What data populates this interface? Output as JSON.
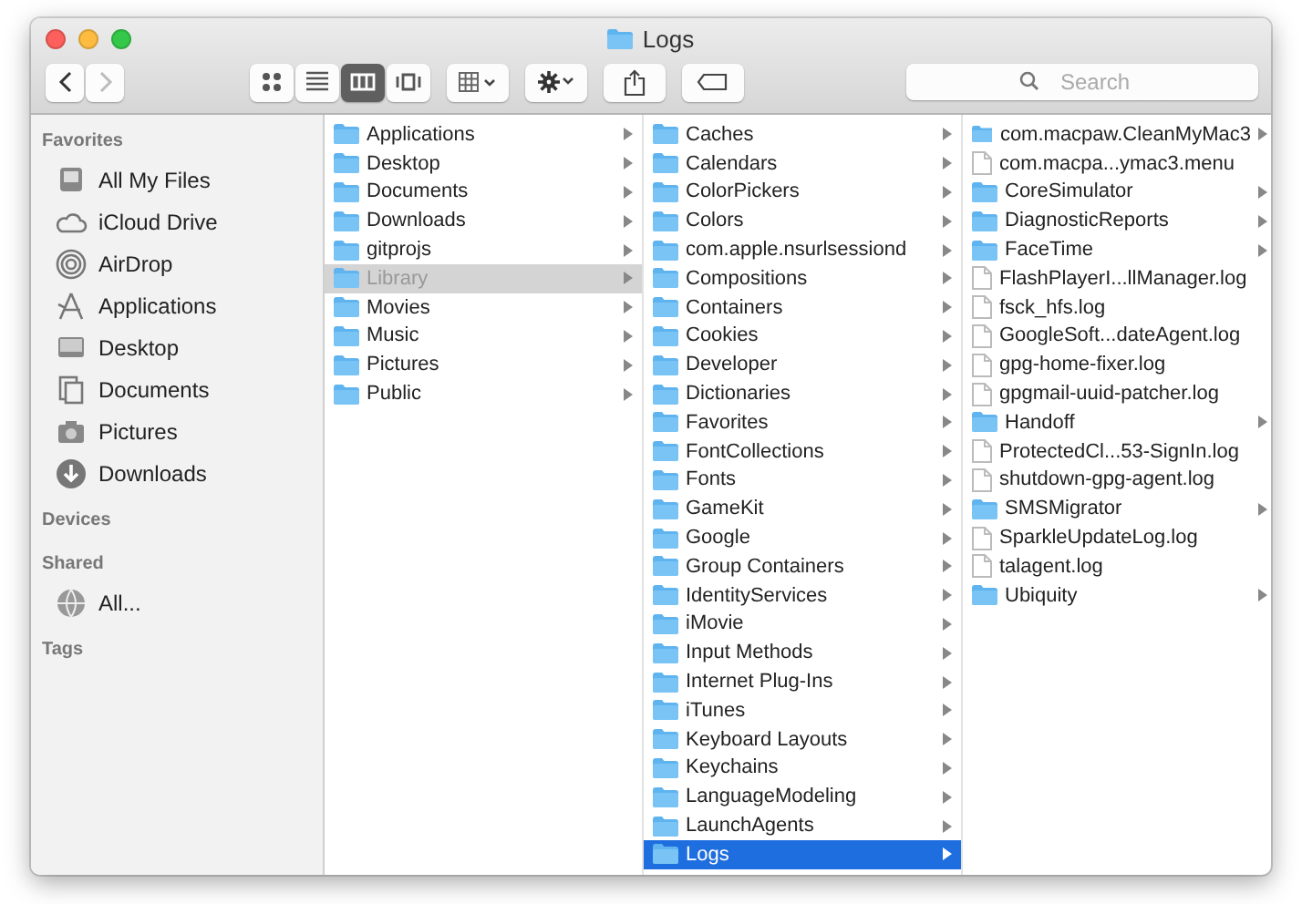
{
  "window": {
    "title": "Logs"
  },
  "toolbar": {
    "view_modes": [
      {
        "selected": false
      },
      {
        "selected": false
      },
      {
        "selected": true
      },
      {
        "selected": false
      }
    ],
    "search": {
      "placeholder": "Search"
    }
  },
  "sidebar": {
    "sections": [
      {
        "title": "Favorites",
        "items": [
          {
            "label": "All My Files"
          },
          {
            "label": "iCloud Drive"
          },
          {
            "label": "AirDrop"
          },
          {
            "label": "Applications"
          },
          {
            "label": "Desktop"
          },
          {
            "label": "Documents"
          },
          {
            "label": "Pictures"
          },
          {
            "label": "Downloads"
          }
        ]
      },
      {
        "title": "Devices"
      },
      {
        "title": "Shared",
        "items": [
          {
            "label": "All..."
          }
        ]
      },
      {
        "title": "Tags"
      }
    ]
  },
  "columns": [
    {
      "items": [
        {
          "name": "Applications",
          "kind": "folder",
          "selected": false
        },
        {
          "name": "Desktop",
          "kind": "folder",
          "selected": false
        },
        {
          "name": "Documents",
          "kind": "folder",
          "selected": false
        },
        {
          "name": "Downloads",
          "kind": "folder",
          "selected": false
        },
        {
          "name": "gitprojs",
          "kind": "folder",
          "selected": false
        },
        {
          "name": "Library",
          "kind": "folder",
          "selected": true,
          "focused": false,
          "dimmed": true
        },
        {
          "name": "Movies",
          "kind": "folder",
          "selected": false
        },
        {
          "name": "Music",
          "kind": "folder",
          "selected": false
        },
        {
          "name": "Pictures",
          "kind": "folder",
          "selected": false
        },
        {
          "name": "Public",
          "kind": "folder",
          "selected": false
        }
      ]
    },
    {
      "items": [
        {
          "name": "Caches",
          "kind": "folder",
          "selected": false
        },
        {
          "name": "Calendars",
          "kind": "folder",
          "selected": false
        },
        {
          "name": "ColorPickers",
          "kind": "folder",
          "selected": false
        },
        {
          "name": "Colors",
          "kind": "folder",
          "selected": false
        },
        {
          "name": "com.apple.nsurlsessiond",
          "kind": "folder",
          "selected": false
        },
        {
          "name": "Compositions",
          "kind": "folder",
          "selected": false
        },
        {
          "name": "Containers",
          "kind": "folder",
          "selected": false
        },
        {
          "name": "Cookies",
          "kind": "folder",
          "selected": false
        },
        {
          "name": "Developer",
          "kind": "folder",
          "selected": false
        },
        {
          "name": "Dictionaries",
          "kind": "folder",
          "selected": false
        },
        {
          "name": "Favorites",
          "kind": "folder",
          "selected": false
        },
        {
          "name": "FontCollections",
          "kind": "folder",
          "selected": false
        },
        {
          "name": "Fonts",
          "kind": "folder",
          "selected": false
        },
        {
          "name": "GameKit",
          "kind": "folder",
          "selected": false
        },
        {
          "name": "Google",
          "kind": "folder",
          "selected": false
        },
        {
          "name": "Group Containers",
          "kind": "folder",
          "selected": false
        },
        {
          "name": "IdentityServices",
          "kind": "folder",
          "selected": false
        },
        {
          "name": "iMovie",
          "kind": "folder",
          "selected": false
        },
        {
          "name": "Input Methods",
          "kind": "folder",
          "selected": false
        },
        {
          "name": "Internet Plug-Ins",
          "kind": "folder",
          "selected": false
        },
        {
          "name": "iTunes",
          "kind": "folder",
          "selected": false
        },
        {
          "name": "Keyboard Layouts",
          "kind": "folder",
          "selected": false
        },
        {
          "name": "Keychains",
          "kind": "folder",
          "selected": false
        },
        {
          "name": "LanguageModeling",
          "kind": "folder",
          "selected": false
        },
        {
          "name": "LaunchAgents",
          "kind": "folder",
          "selected": false
        },
        {
          "name": "Logs",
          "kind": "folder",
          "selected": true,
          "focused": true
        }
      ]
    },
    {
      "items": [
        {
          "name": "com.macpaw.CleanMyMac3",
          "kind": "folder",
          "selected": false
        },
        {
          "name": "com.macpa...ymac3.menu",
          "kind": "file",
          "selected": false
        },
        {
          "name": "CoreSimulator",
          "kind": "folder",
          "selected": false
        },
        {
          "name": "DiagnosticReports",
          "kind": "folder",
          "selected": false
        },
        {
          "name": "FaceTime",
          "kind": "folder",
          "selected": false
        },
        {
          "name": "FlashPlayerI...llManager.log",
          "kind": "file",
          "selected": false
        },
        {
          "name": "fsck_hfs.log",
          "kind": "file",
          "selected": false
        },
        {
          "name": "GoogleSoft...dateAgent.log",
          "kind": "file",
          "selected": false
        },
        {
          "name": "gpg-home-fixer.log",
          "kind": "file",
          "selected": false
        },
        {
          "name": "gpgmail-uuid-patcher.log",
          "kind": "file",
          "selected": false
        },
        {
          "name": "Handoff",
          "kind": "folder",
          "selected": false
        },
        {
          "name": "ProtectedCl...53-SignIn.log",
          "kind": "file",
          "selected": false
        },
        {
          "name": "shutdown-gpg-agent.log",
          "kind": "file",
          "selected": false
        },
        {
          "name": "SMSMigrator",
          "kind": "folder",
          "selected": false
        },
        {
          "name": "SparkleUpdateLog.log",
          "kind": "file",
          "selected": false
        },
        {
          "name": "talagent.log",
          "kind": "file",
          "selected": false
        },
        {
          "name": "Ubiquity",
          "kind": "folder",
          "selected": false
        }
      ]
    }
  ]
}
